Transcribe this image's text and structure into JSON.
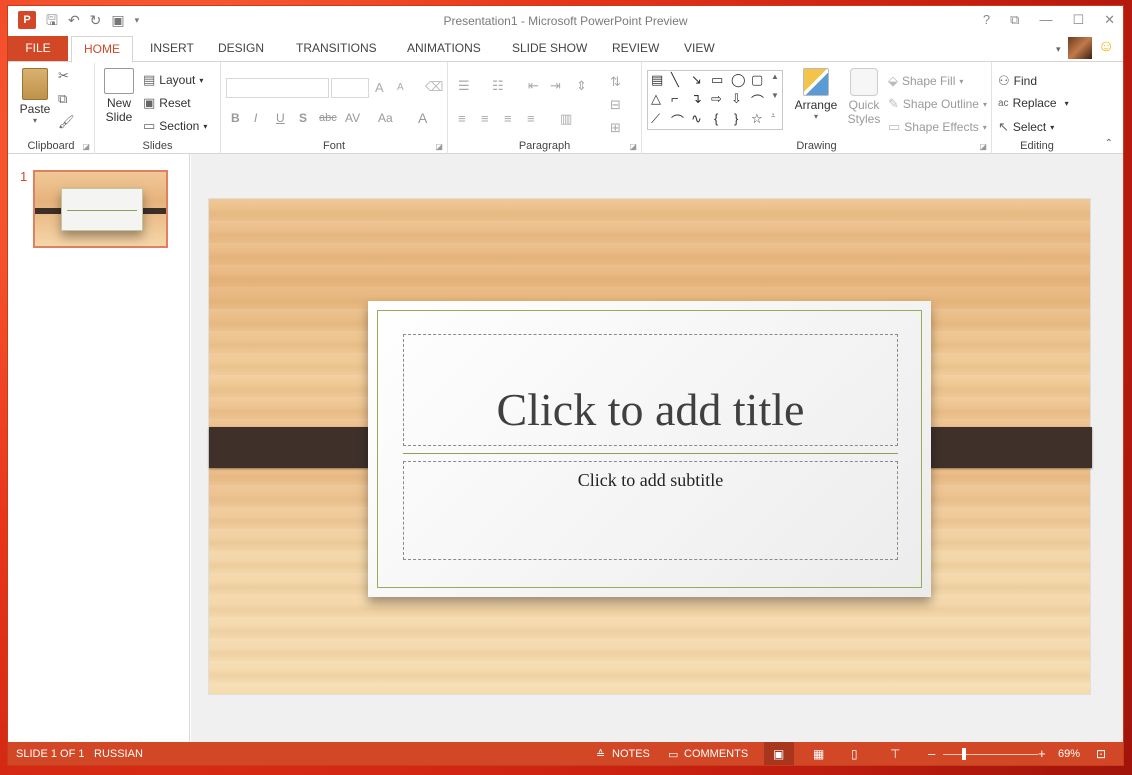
{
  "window": {
    "title": "Presentation1 - Microsoft PowerPoint Preview",
    "controls": {
      "help": "?",
      "restore_icon": "⧉",
      "minimize": "—",
      "maximize": "☐",
      "close": "✕"
    }
  },
  "qat": {
    "logo": "P",
    "save_icon": "save-icon",
    "undo_icon": "undo-icon",
    "redo_icon": "redo-icon",
    "present_icon": "present-icon"
  },
  "tabs": {
    "file": "FILE",
    "home": "HOME",
    "insert": "INSERT",
    "design": "DESIGN",
    "transitions": "TRANSITIONS",
    "animations": "ANIMATIONS",
    "slideshow": "SLIDE SHOW",
    "review": "REVIEW",
    "view": "VIEW"
  },
  "ribbon": {
    "clipboard": {
      "label": "Clipboard",
      "paste": "Paste"
    },
    "slides": {
      "label": "Slides",
      "new_slide": "New",
      "new_slide2": "Slide",
      "layout": "Layout",
      "reset": "Reset",
      "section": "Section"
    },
    "font": {
      "label": "Font",
      "bold": "B",
      "italic": "I",
      "underline": "U",
      "shadow": "S",
      "strike": "abc",
      "spacing": "AV",
      "case": "Aa",
      "color": "A",
      "grow": "A",
      "shrink": "A"
    },
    "paragraph": {
      "label": "Paragraph"
    },
    "drawing": {
      "label": "Drawing",
      "arrange": "Arrange",
      "quick_styles": "Quick",
      "quick_styles2": "Styles",
      "shape_fill": "Shape Fill",
      "shape_outline": "Shape Outline",
      "shape_effects": "Shape Effects"
    },
    "editing": {
      "label": "Editing",
      "find": "Find",
      "replace": "Replace",
      "select": "Select"
    }
  },
  "thumbnails": {
    "slide1_number": "1"
  },
  "slide": {
    "title_placeholder": "Click to add title",
    "subtitle_placeholder": "Click to add subtitle"
  },
  "status": {
    "slide_info": "SLIDE 1 OF 1",
    "language": "RUSSIAN",
    "notes": "NOTES",
    "comments": "COMMENTS",
    "zoom_out": "–",
    "zoom_in": "+",
    "zoom": "69%"
  },
  "colors": {
    "accent": "#d24726",
    "band": "#3f312a",
    "card_border": "#93ad5b"
  }
}
